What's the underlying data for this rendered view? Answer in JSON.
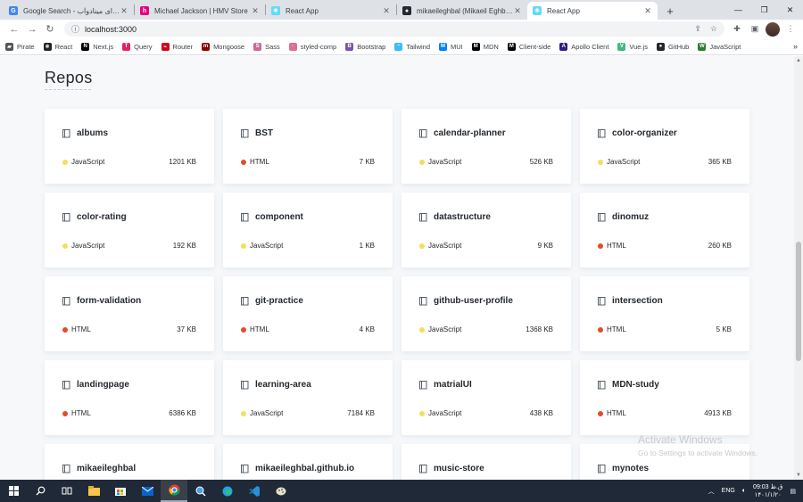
{
  "browser": {
    "tabs": [
      {
        "title": "Google Search - هوای مینادوآب",
        "favicon_color": "#4285f4",
        "favicon_letter": "G",
        "active": false
      },
      {
        "title": "Michael Jackson | HMV Store",
        "favicon_color": "#e6007e",
        "favicon_letter": "h",
        "active": false
      },
      {
        "title": "React App",
        "favicon_color": "#61dafb",
        "favicon_letter": "⚛",
        "active": false
      },
      {
        "title": "mikaeileghbal (Mikaeil Eghbal)",
        "favicon_color": "#24292f",
        "favicon_letter": "●",
        "active": false
      },
      {
        "title": "React App",
        "favicon_color": "#61dafb",
        "favicon_letter": "⚛",
        "active": true
      }
    ],
    "new_tab_label": "+",
    "url": "localhost:3000",
    "bookmarks": [
      {
        "label": "Pirate",
        "icon_color": "#555",
        "glyph": "▰"
      },
      {
        "label": "React",
        "icon_color": "#20232a",
        "glyph": "⚛"
      },
      {
        "label": "Next.js",
        "icon_color": "#000",
        "glyph": "N"
      },
      {
        "label": "Query",
        "icon_color": "#e91e63",
        "glyph": "T"
      },
      {
        "label": "Router",
        "icon_color": "#d0021b",
        "glyph": "⌁"
      },
      {
        "label": "Mongoose",
        "icon_color": "#880000",
        "glyph": "m"
      },
      {
        "label": "Sass",
        "icon_color": "#cd6799",
        "glyph": "S"
      },
      {
        "label": "styled-comp",
        "icon_color": "#db7093",
        "glyph": "·"
      },
      {
        "label": "Bootstrap",
        "icon_color": "#7952b3",
        "glyph": "B"
      },
      {
        "label": "Tailwind",
        "icon_color": "#38bdf8",
        "glyph": "~"
      },
      {
        "label": "MUI",
        "icon_color": "#007fff",
        "glyph": "M"
      },
      {
        "label": "MDN",
        "icon_color": "#000",
        "glyph": "M"
      },
      {
        "label": "Client-side",
        "icon_color": "#000",
        "glyph": "M"
      },
      {
        "label": "Apollo Client",
        "icon_color": "#311c87",
        "glyph": "A"
      },
      {
        "label": "Vue.js",
        "icon_color": "#41b883",
        "glyph": "V"
      },
      {
        "label": "GitHub",
        "icon_color": "#24292f",
        "glyph": "●"
      },
      {
        "label": "JavaScript",
        "icon_color": "#2e7d32",
        "glyph": "W"
      }
    ],
    "bookmarks_more": "»"
  },
  "page": {
    "heading": "Repos",
    "repos": [
      {
        "name": "albums",
        "language": "JavaScript",
        "size": "1201 KB"
      },
      {
        "name": "BST",
        "language": "HTML",
        "size": "7 KB"
      },
      {
        "name": "calendar-planner",
        "language": "JavaScript",
        "size": "526 KB"
      },
      {
        "name": "color-organizer",
        "language": "JavaScript",
        "size": "365 KB"
      },
      {
        "name": "color-rating",
        "language": "JavaScript",
        "size": "192 KB"
      },
      {
        "name": "component",
        "language": "JavaScript",
        "size": "1 KB"
      },
      {
        "name": "datastructure",
        "language": "JavaScript",
        "size": "9 KB"
      },
      {
        "name": "dinomuz",
        "language": "HTML",
        "size": "260 KB"
      },
      {
        "name": "form-validation",
        "language": "HTML",
        "size": "37 KB"
      },
      {
        "name": "git-practice",
        "language": "HTML",
        "size": "4 KB"
      },
      {
        "name": "github-user-profile",
        "language": "JavaScript",
        "size": "1368 KB"
      },
      {
        "name": "intersection",
        "language": "HTML",
        "size": "5 KB"
      },
      {
        "name": "landingpage",
        "language": "HTML",
        "size": "6386 KB"
      },
      {
        "name": "learning-area",
        "language": "JavaScript",
        "size": "7184 KB"
      },
      {
        "name": "matrialUI",
        "language": "JavaScript",
        "size": "438 KB"
      },
      {
        "name": "MDN-study",
        "language": "HTML",
        "size": "4913 KB"
      },
      {
        "name": "mikaeileghbal",
        "language": "",
        "size": ""
      },
      {
        "name": "mikaeileghbal.github.io",
        "language": "",
        "size": ""
      },
      {
        "name": "music-store",
        "language": "",
        "size": ""
      },
      {
        "name": "mynotes",
        "language": "",
        "size": ""
      }
    ],
    "language_colors": {
      "JavaScript": "#f1e05a",
      "HTML": "#e34c26"
    }
  },
  "watermark": {
    "line1": "Activate Windows",
    "line2": "Go to Settings to activate Windows."
  },
  "taskbar": {
    "language": "ENG",
    "time": "09:03 ق.ظ",
    "date": "۱۴۰۱/۱/۲۰"
  }
}
